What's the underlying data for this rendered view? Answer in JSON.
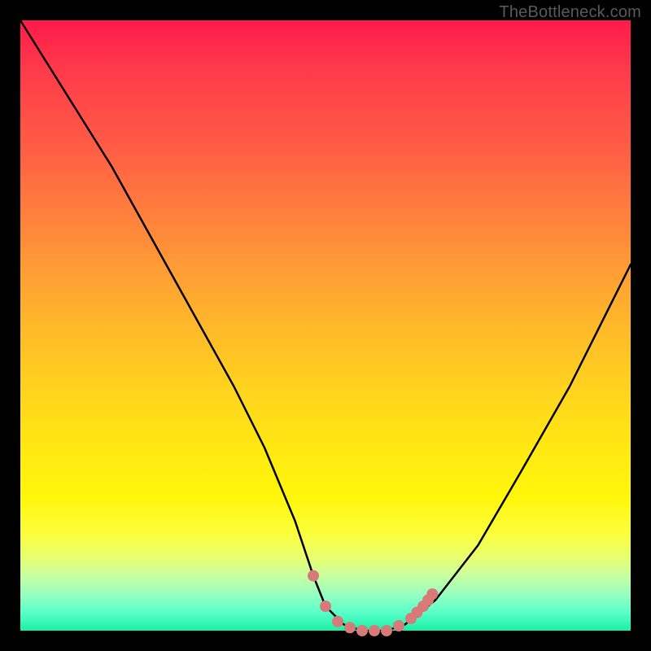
{
  "watermark": "TheBottleneck.com",
  "chart_data": {
    "type": "line",
    "title": "",
    "xlabel": "",
    "ylabel": "",
    "xlim": [
      0,
      100
    ],
    "ylim": [
      0,
      100
    ],
    "series": [
      {
        "name": "bottleneck-curve",
        "x": [
          0,
          5,
          10,
          15,
          20,
          25,
          30,
          35,
          40,
          45,
          48,
          50,
          53,
          56,
          58,
          60,
          63,
          68,
          75,
          82,
          90,
          100
        ],
        "values": [
          100,
          92,
          84,
          76,
          67,
          58,
          49,
          40,
          30,
          18,
          9,
          4,
          1,
          0,
          0,
          0,
          1,
          5,
          14,
          26,
          40,
          60
        ]
      }
    ],
    "markers": {
      "name": "highlight-dots",
      "color": "#d97a7a",
      "points": [
        {
          "x": 48,
          "y": 9
        },
        {
          "x": 50,
          "y": 4
        },
        {
          "x": 52,
          "y": 1.5
        },
        {
          "x": 54,
          "y": 0.5
        },
        {
          "x": 56,
          "y": 0
        },
        {
          "x": 58,
          "y": 0
        },
        {
          "x": 60,
          "y": 0
        },
        {
          "x": 62,
          "y": 0.8
        },
        {
          "x": 64,
          "y": 2
        },
        {
          "x": 65,
          "y": 3
        },
        {
          "x": 66,
          "y": 4
        },
        {
          "x": 66.8,
          "y": 5
        },
        {
          "x": 67.5,
          "y": 6
        }
      ]
    },
    "colors": {
      "curve": "#000000",
      "marker": "#d97a7a",
      "gradient_top": "#ff1a4a",
      "gradient_bottom": "#18f0a8"
    }
  }
}
